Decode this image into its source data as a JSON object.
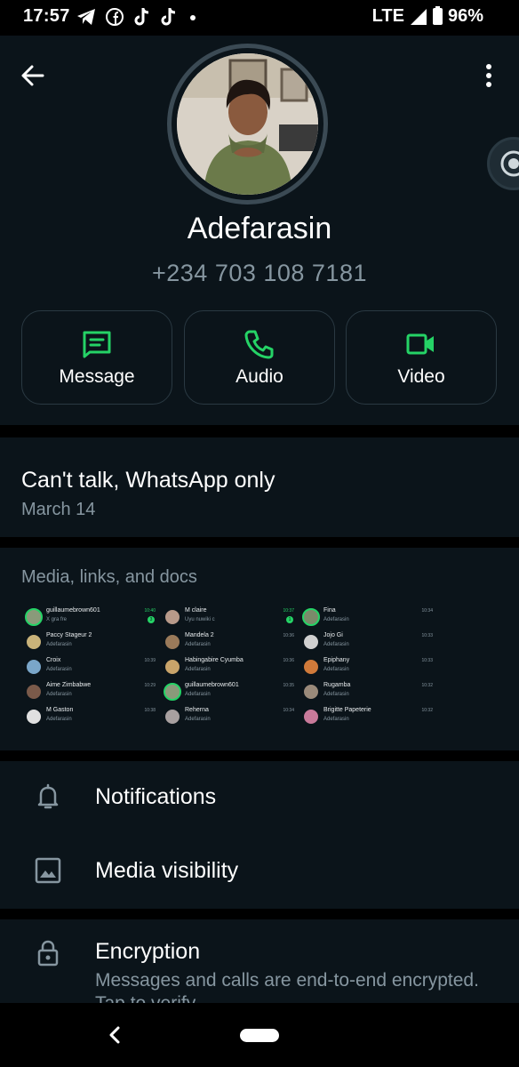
{
  "status_bar": {
    "time": "17:57",
    "network": "LTE",
    "battery": "96%",
    "left_icons": [
      "telegram-icon",
      "facebook-icon",
      "tiktok-icon",
      "tiktok-icon",
      "dot-icon"
    ]
  },
  "contact": {
    "name": "Adefarasin",
    "phone": "+234 703 108 7181"
  },
  "actions": [
    {
      "label": "Message",
      "icon": "message-icon"
    },
    {
      "label": "Audio",
      "icon": "phone-icon"
    },
    {
      "label": "Video",
      "icon": "video-icon"
    }
  ],
  "about": {
    "text": "Can't talk, WhatsApp only",
    "date": "March 14"
  },
  "media": {
    "title": "Media, links, and docs",
    "thumbnails": [
      {
        "rows": [
          {
            "name": "guillaumebrown601",
            "sub": "X gra fre",
            "time": "10:40",
            "badge": "3"
          },
          {
            "name": "Paccy Stageur 2",
            "sub": "Adefarasin",
            "time": "",
            "badge": ""
          },
          {
            "name": "Croix",
            "sub": "Adefarasin",
            "time": "10:39",
            "badge": ""
          },
          {
            "name": "Aime Zimbabwe",
            "sub": "Adefarasin",
            "time": "10:29",
            "badge": ""
          },
          {
            "name": "M Gaston",
            "sub": "Adefarasin",
            "time": "10:38",
            "badge": ""
          }
        ]
      },
      {
        "rows": [
          {
            "name": "M claire",
            "sub": "Uyu nuwiki c",
            "time": "10:37",
            "badge": "1"
          },
          {
            "name": "Mandela 2",
            "sub": "Adefarasin",
            "time": "10:36",
            "badge": ""
          },
          {
            "name": "Habingabire Cyumba",
            "sub": "Adefarasin",
            "time": "10:36",
            "badge": ""
          },
          {
            "name": "guillaumebrown601",
            "sub": "Adefarasin",
            "time": "10:35",
            "badge": ""
          },
          {
            "name": "Reherna",
            "sub": "Adefarasin",
            "time": "10:34",
            "badge": ""
          }
        ]
      },
      {
        "rows": [
          {
            "name": "Fina",
            "sub": "Adefarasin",
            "time": "10:34",
            "badge": ""
          },
          {
            "name": "Jojo Gi",
            "sub": "Adefarasin",
            "time": "10:33",
            "badge": ""
          },
          {
            "name": "Epiphany",
            "sub": "Adefarasin",
            "time": "10:33",
            "badge": ""
          },
          {
            "name": "Rugamba",
            "sub": "Adefarasin",
            "time": "10:32",
            "badge": ""
          },
          {
            "name": "Brigitte Papeterie",
            "sub": "Adefarasin",
            "time": "10:32",
            "badge": ""
          }
        ]
      }
    ]
  },
  "settings": [
    {
      "label": "Notifications",
      "icon": "bell-icon"
    },
    {
      "label": "Media visibility",
      "icon": "image-icon"
    }
  ],
  "encryption": {
    "title": "Encryption",
    "subtitle": "Messages and calls are end-to-end encrypted. Tap to verify."
  },
  "colors": {
    "accent": "#25d366",
    "background": "#0b141a",
    "divider": "#000000",
    "secondary_text": "#8696a0"
  }
}
